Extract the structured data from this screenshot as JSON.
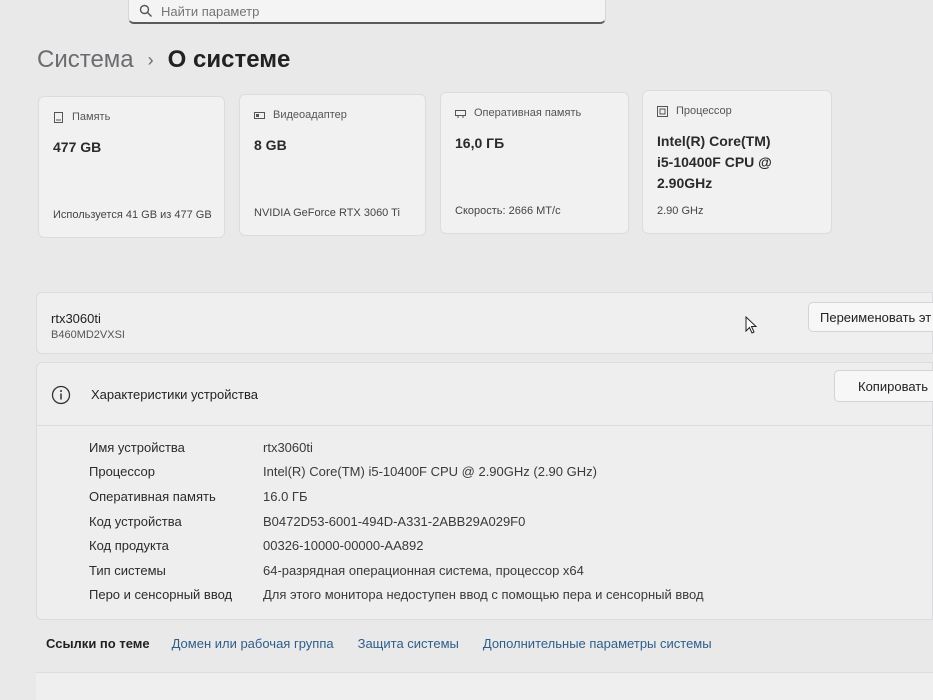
{
  "search": {
    "placeholder": "Найти параметр"
  },
  "breadcrumb": {
    "parent": "Система",
    "separator": "›",
    "current": "О системе"
  },
  "cards": [
    {
      "label": "Память",
      "value": "477 GB",
      "sub": "Используется 41 GB из 477 GB",
      "icon": "storage-icon"
    },
    {
      "label": "Видеоадаптер",
      "value": "8 GB",
      "sub": "NVIDIA GeForce RTX 3060 Ti",
      "icon": "gpu-icon"
    },
    {
      "label": "Оперативная память",
      "value": "16,0 ГБ",
      "sub": "Скорость: 2666 MT/c",
      "icon": "ram-icon"
    },
    {
      "label": "Процессор",
      "value_lines": [
        "Intel(R) Core(TM)",
        "i5-10400F CPU @",
        "2.90GHz"
      ],
      "sub": "2.90 GHz",
      "icon": "cpu-icon"
    }
  ],
  "device": {
    "name": "rtx3060ti",
    "model": "B460MD2VXSI",
    "rename_label": "Переименовать эт"
  },
  "specs": {
    "title": "Характеристики устройства",
    "copy_label": "Копировать",
    "rows": [
      {
        "key": "Имя устройства",
        "value": "rtx3060ti"
      },
      {
        "key": "Процессор",
        "value": "Intel(R) Core(TM) i5-10400F CPU @ 2.90GHz (2.90 GHz)"
      },
      {
        "key": "Оперативная память",
        "value": "16.0 ГБ"
      },
      {
        "key": "Код устройства",
        "value": "B0472D53-6001-494D-A331-2ABB29A029F0"
      },
      {
        "key": "Код продукта",
        "value": "00326-10000-00000-AA892"
      },
      {
        "key": "Тип системы",
        "value": "64-разрядная операционная система, процессор x64"
      },
      {
        "key": "Перо и сенсорный ввод",
        "value": "Для этого монитора недоступен ввод с помощью пера и сенсорный ввод"
      }
    ]
  },
  "related": {
    "label": "Ссылки по теме",
    "links": [
      "Домен или рабочая группа",
      "Защита системы",
      "Дополнительные параметры системы"
    ]
  },
  "colors": {
    "link": "#2f5d8a",
    "background": "#e9e9ea",
    "card": "#f1f1f2"
  }
}
